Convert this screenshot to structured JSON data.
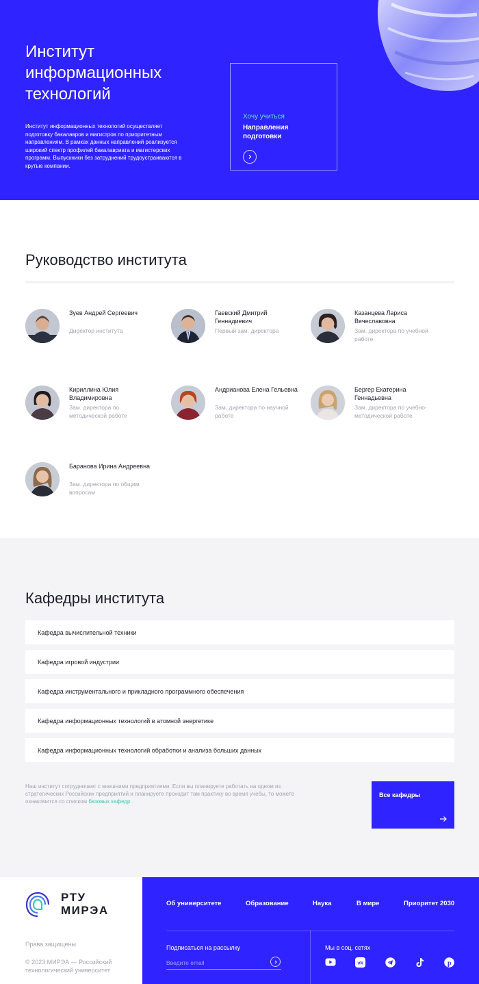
{
  "hero": {
    "title": "Институт информационных технологий",
    "description": "Институт информационных технологий осуществляет подготовку бакалавров и магистров по приоритетным направлениям. В рамках данных направлений реализуется широкий спектр профилей бакалавриата и магистерских программ. Выпускники без затруднений трудоустраиваются в крутые компании.",
    "card": {
      "kicker": "Хочу учиться",
      "label": "Направления подготовки",
      "icon": "chevron-right-icon"
    }
  },
  "leadership": {
    "title": "Руководство института",
    "people": [
      {
        "name": "Зуев Андрей Сергеевич",
        "role": "Директор института"
      },
      {
        "name": "Гаевский Дмитрий Геннадиевич",
        "role": "Первый зам. директора"
      },
      {
        "name": "Казанцева Лариса Вячеславовна",
        "role": "Зам. директора по учебной работе"
      },
      {
        "name": "Кириллина Юлия Владимировна",
        "role": "Зам. директора по методической работе"
      },
      {
        "name": "Андрианова Елена Гельевна",
        "role": "Зам. директора по научной работе"
      },
      {
        "name": "Бергер Екатерина Геннадьевна",
        "role": "Зам. директора по учебно-методической работе"
      },
      {
        "name": "Баранова Ирина Андреевна",
        "role": "Зам. директора по общим вопросам"
      }
    ]
  },
  "departments": {
    "title": "Кафедры института",
    "items": [
      "Кафедра вычислительной техники",
      "Кафедра игровой индустрии",
      "Кафедра инструментального и прикладного программного обеспечения",
      "Кафедра информационных технологий в атомной энергетике",
      "Кафедра информационных технологий обработки и анализа больших данных"
    ],
    "note": "Наш институт сотрудничает с внешними предприятиями. Если вы планируете работать на одном из стратегических Российских предприятий и планируете проходит там практику во время учебы, то можете ознакомится со списком",
    "note_link": "базовых кафедр",
    "note_end": ".",
    "all_button": "Все кафедры"
  },
  "footer": {
    "logo": {
      "line1": "РТУ",
      "line2": "МИРЭА"
    },
    "rights": "Права защищены",
    "copyright": "© 2023 МИРЭА — Российский технологический университет",
    "nav": [
      "Об университете",
      "Образование",
      "Наука",
      "В мире",
      "Приоритет 2030"
    ],
    "subscribe_label": "Подписаться на рассылку",
    "email_placeholder": "Введите email",
    "social_label": "Мы в соц. сетях",
    "social_icons": [
      "youtube-icon",
      "vk-icon",
      "telegram-icon",
      "tiktok-icon",
      "pinterest-icon"
    ]
  },
  "colors": {
    "brand": "#2f23ff",
    "accent": "#36c9aa",
    "muted": "#a3a4b0",
    "section_bg": "#f4f4f7"
  }
}
